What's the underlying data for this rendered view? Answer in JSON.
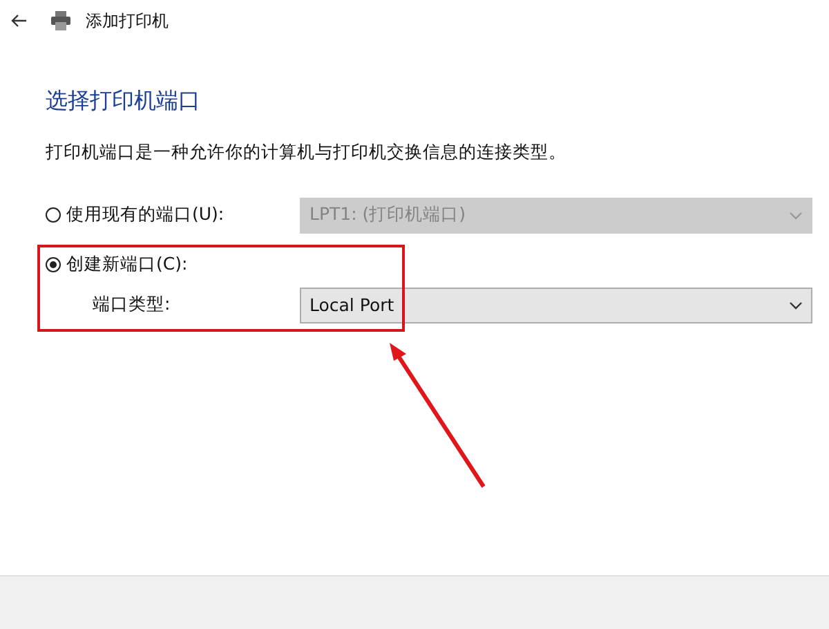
{
  "window": {
    "title": "添加打印机"
  },
  "heading": "选择打印机端口",
  "description": "打印机端口是一种允许你的计算机与打印机交换信息的连接类型。",
  "options": [
    {
      "label": "使用现有的端口(U):",
      "selected": false,
      "dropdown": {
        "value": "LPT1: (打印机端口)",
        "disabled": true
      }
    },
    {
      "label": "创建新端口(C):",
      "selected": true
    }
  ],
  "port_type": {
    "label": "端口类型:",
    "dropdown": {
      "value": "Local Port",
      "disabled": false
    }
  }
}
